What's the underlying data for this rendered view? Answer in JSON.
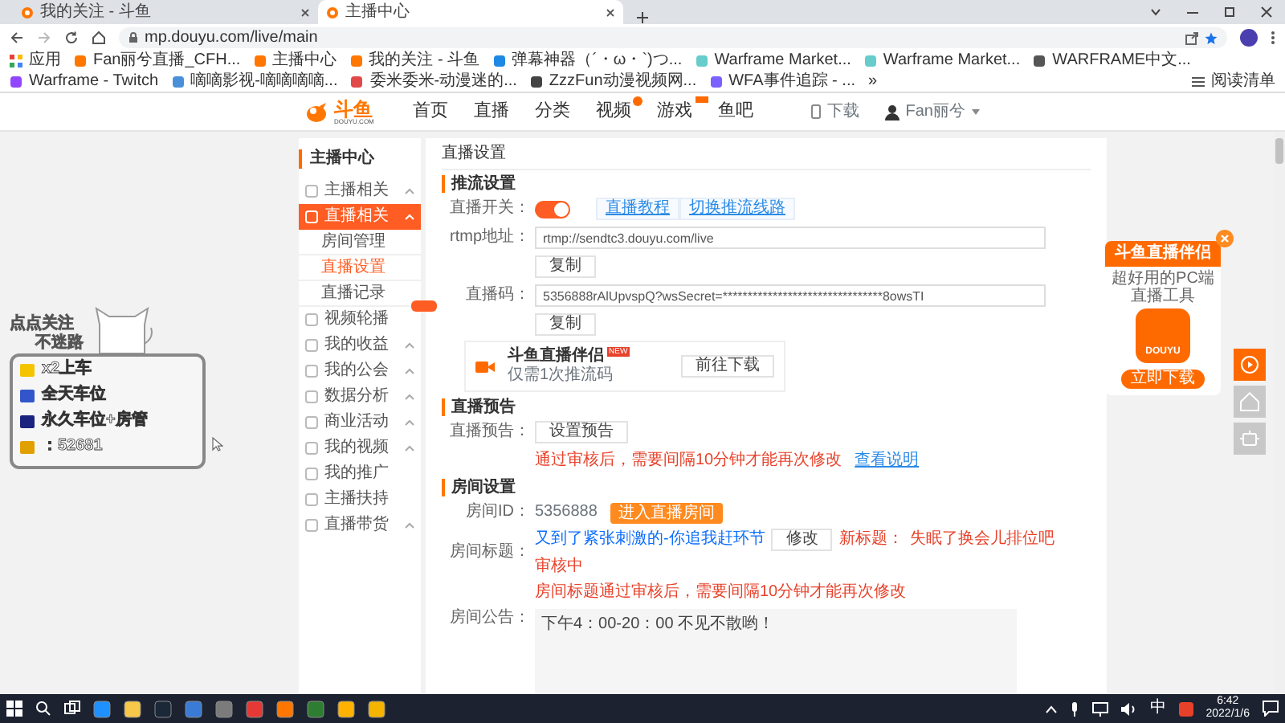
{
  "browser": {
    "tabs": [
      {
        "title": "我的关注 - 斗鱼",
        "selected": false
      },
      {
        "title": "主播中心",
        "selected": true
      }
    ],
    "url": "mp.douyu.com/live/main",
    "bookmarks": [
      "应用",
      "Fan丽兮直播_CFH...",
      "主播中心",
      "我的关注 - 斗鱼",
      "弹幕神器（´・ω・`)つ...",
      "Warframe Market...",
      "Warframe Market...",
      "WARFRAME中文...",
      "Warframe - Twitch",
      "嘀嘀影视-嘀嘀嘀嘀...",
      "委米委米-动漫迷的...",
      "ZzzFun动漫视频网...",
      "WFA事件追踪 - ..."
    ],
    "more": "»",
    "reading_list": "阅读清单"
  },
  "site_header": {
    "logo": "斗鱼",
    "logo_sub": "DOUYU.COM",
    "nav": [
      {
        "label": "首页",
        "dot": false,
        "hot_flag": false
      },
      {
        "label": "直播",
        "dot": false,
        "hot_flag": false
      },
      {
        "label": "分类",
        "dot": false,
        "hot_flag": false
      },
      {
        "label": "视频",
        "dot": true,
        "hot_flag": false
      },
      {
        "label": "游戏",
        "dot": false,
        "hot_flag": true
      },
      {
        "label": "鱼吧",
        "dot": false,
        "hot_flag": false
      }
    ],
    "download": "下载",
    "user": "Fan丽兮"
  },
  "overlay": {
    "follow": [
      "点点关注",
      "不迷路"
    ],
    "perks": [
      "x2上车",
      "全天车位",
      "永久车位+房管",
      "：52681"
    ]
  },
  "sidebar": {
    "title": "主播中心",
    "items": [
      {
        "label": "主播相关",
        "expandable": true,
        "selected": false,
        "badge": false
      },
      {
        "label": "直播相关",
        "expandable": true,
        "selected": true,
        "badge": false,
        "children": [
          {
            "label": "房间管理",
            "selected": false
          },
          {
            "label": "直播设置",
            "selected": true
          },
          {
            "label": "直播记录",
            "selected": false
          }
        ]
      },
      {
        "label": "视频轮播",
        "expandable": false,
        "selected": false,
        "badge": true
      },
      {
        "label": "我的收益",
        "expandable": true,
        "selected": false,
        "badge": false
      },
      {
        "label": "我的公会",
        "expandable": true,
        "selected": false,
        "badge": false
      },
      {
        "label": "数据分析",
        "expandable": true,
        "selected": false,
        "badge": false
      },
      {
        "label": "商业活动",
        "expandable": true,
        "selected": false,
        "badge": false
      },
      {
        "label": "我的视频",
        "expandable": true,
        "selected": false,
        "badge": false
      },
      {
        "label": "我的推广",
        "expandable": false,
        "selected": false,
        "badge": false
      },
      {
        "label": "主播扶持",
        "expandable": false,
        "selected": false,
        "badge": false
      },
      {
        "label": "直播带货",
        "expandable": true,
        "selected": false,
        "badge": false
      }
    ]
  },
  "main": {
    "title": "直播设置",
    "stream": {
      "title": "推流设置",
      "switch_label": "直播开关：",
      "switch_on": true,
      "links": [
        "直播教程",
        "切换推流线路"
      ],
      "rtmp_label": "rtmp地址：",
      "rtmp_value": "rtmp://sendtc3.douyu.com/live",
      "rtmp_button": "复制",
      "code_label": "直播码：",
      "code_value": "5356888rAlUpvspQ?wsSecret=********************************8owsTI",
      "code_button": "复制",
      "companion": {
        "name": "斗鱼直播伴侣",
        "tag": "NEW",
        "subtitle": "仅需1次推流码",
        "button": "前往下载"
      }
    },
    "preview": {
      "title": "直播预告",
      "label": "直播预告：",
      "button": "设置预告",
      "notice": "通过审核后，需要间隔10分钟才能再次修改",
      "link": "查看说明"
    },
    "room": {
      "title": "房间设置",
      "id_label": "房间ID：",
      "id": "5356888",
      "enter_button": "进入直播房间",
      "title_label": "房间标题：",
      "room_title": "又到了紧张刺激的-你追我赶环节",
      "edit_button": "修改",
      "new_title_label": "新标题：",
      "new_title": "失眠了换会儿排位吧",
      "review_status": "审核中",
      "title_notice": "房间标题通过审核后，需要间隔10分钟才能再次修改",
      "announce_label": "房间公告：",
      "announcement": "下午4：00-20：00 不见不散哟！"
    }
  },
  "ad": {
    "title": "斗鱼直播伴侣",
    "subtitle": "超好用的PC端直播工具",
    "app_label": "DOUYU",
    "button": "立即下载"
  },
  "taskbar": {
    "ime": "中",
    "time": "6:42",
    "date": "2022/1/6"
  }
}
